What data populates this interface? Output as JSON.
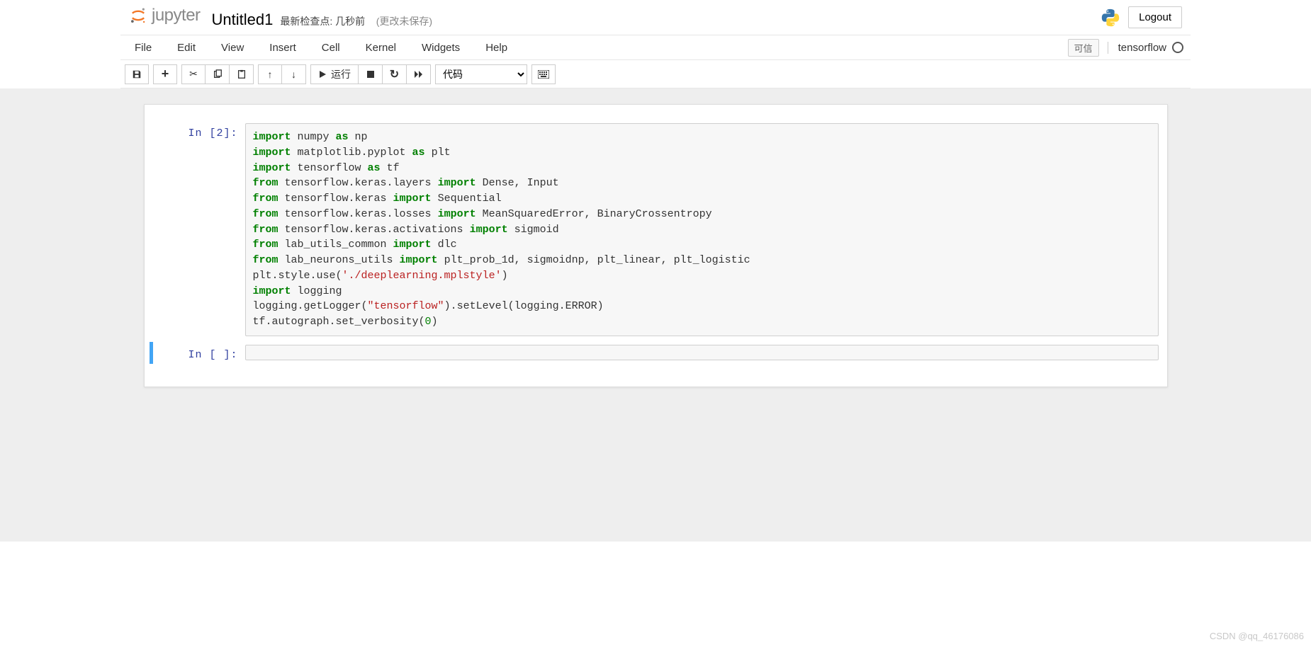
{
  "header": {
    "logo_text": "jupyter",
    "title": "Untitled1",
    "checkpoint": "最新检查点: 几秒前",
    "unsaved": "(更改未保存)",
    "logout": "Logout"
  },
  "menu": {
    "file": "File",
    "edit": "Edit",
    "view": "View",
    "insert": "Insert",
    "cell": "Cell",
    "kernel": "Kernel",
    "widgets": "Widgets",
    "help": "Help",
    "trusted": "可信",
    "kernel_name": "tensorflow"
  },
  "toolbar": {
    "run_label": "运行",
    "cell_type": "代码"
  },
  "cells": [
    {
      "prompt": "In [2]:",
      "tokens": [
        [
          {
            "t": "kw",
            "v": "import"
          },
          {
            "t": "",
            "v": " numpy "
          },
          {
            "t": "kw",
            "v": "as"
          },
          {
            "t": "",
            "v": " np"
          }
        ],
        [
          {
            "t": "kw",
            "v": "import"
          },
          {
            "t": "",
            "v": " matplotlib.pyplot "
          },
          {
            "t": "kw",
            "v": "as"
          },
          {
            "t": "",
            "v": " plt"
          }
        ],
        [
          {
            "t": "kw",
            "v": "import"
          },
          {
            "t": "",
            "v": " tensorflow "
          },
          {
            "t": "kw",
            "v": "as"
          },
          {
            "t": "",
            "v": " tf"
          }
        ],
        [
          {
            "t": "kw",
            "v": "from"
          },
          {
            "t": "",
            "v": " tensorflow.keras.layers "
          },
          {
            "t": "kw",
            "v": "import"
          },
          {
            "t": "",
            "v": " Dense, Input"
          }
        ],
        [
          {
            "t": "kw",
            "v": "from"
          },
          {
            "t": "",
            "v": " tensorflow.keras "
          },
          {
            "t": "kw",
            "v": "import"
          },
          {
            "t": "",
            "v": " Sequential"
          }
        ],
        [
          {
            "t": "kw",
            "v": "from"
          },
          {
            "t": "",
            "v": " tensorflow.keras.losses "
          },
          {
            "t": "kw",
            "v": "import"
          },
          {
            "t": "",
            "v": " MeanSquaredError, BinaryCrossentropy"
          }
        ],
        [
          {
            "t": "kw",
            "v": "from"
          },
          {
            "t": "",
            "v": " tensorflow.keras.activations "
          },
          {
            "t": "kw",
            "v": "import"
          },
          {
            "t": "",
            "v": " sigmoid"
          }
        ],
        [
          {
            "t": "kw",
            "v": "from"
          },
          {
            "t": "",
            "v": " lab_utils_common "
          },
          {
            "t": "kw",
            "v": "import"
          },
          {
            "t": "",
            "v": " dlc"
          }
        ],
        [
          {
            "t": "kw",
            "v": "from"
          },
          {
            "t": "",
            "v": " lab_neurons_utils "
          },
          {
            "t": "kw",
            "v": "import"
          },
          {
            "t": "",
            "v": " plt_prob_1d, sigmoidnp, plt_linear, plt_logistic"
          }
        ],
        [
          {
            "t": "",
            "v": "plt.style.use("
          },
          {
            "t": "str",
            "v": "'./deeplearning.mplstyle'"
          },
          {
            "t": "",
            "v": ")"
          }
        ],
        [
          {
            "t": "kw",
            "v": "import"
          },
          {
            "t": "",
            "v": " logging"
          }
        ],
        [
          {
            "t": "",
            "v": "logging.getLogger("
          },
          {
            "t": "str",
            "v": "\"tensorflow\""
          },
          {
            "t": "",
            "v": ").setLevel(logging.ERROR)"
          }
        ],
        [
          {
            "t": "",
            "v": "tf.autograph.set_verbosity("
          },
          {
            "t": "num",
            "v": "0"
          },
          {
            "t": "",
            "v": ")"
          }
        ]
      ]
    },
    {
      "prompt": "In [ ]:",
      "tokens": []
    }
  ],
  "watermark": "CSDN @qq_46176086"
}
